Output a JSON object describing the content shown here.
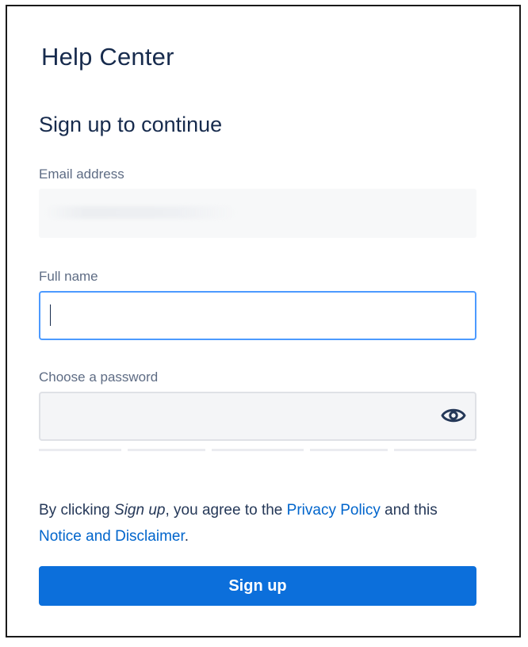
{
  "app": {
    "title": "Help Center"
  },
  "form": {
    "heading": "Sign up to continue",
    "email": {
      "label": "Email address",
      "value": ""
    },
    "full_name": {
      "label": "Full name",
      "value": "",
      "placeholder": ""
    },
    "password": {
      "label": "Choose a password",
      "value": "",
      "toggle_icon": "eye-icon"
    },
    "legal": {
      "prefix": "By clicking ",
      "action": "Sign up",
      "middle": ", you agree to the ",
      "privacy_link": "Privacy Policy",
      "and": " and this ",
      "notice_link": "Notice and Disclaimer",
      "suffix": "."
    },
    "submit_label": "Sign up"
  },
  "colors": {
    "primary": "#0c6fdb",
    "focus_border": "#4c9aff",
    "heading_text": "#172b4d",
    "label_text": "#5e6c84",
    "link": "#0052cc"
  }
}
